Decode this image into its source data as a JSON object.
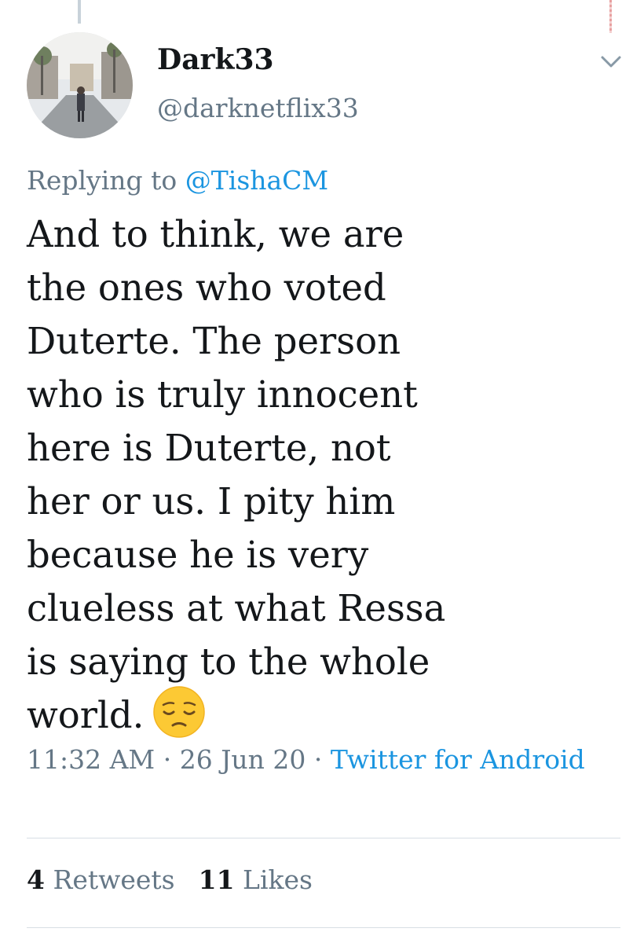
{
  "tweet": {
    "author": {
      "display_name": "Dark33",
      "handle": "@darknetflix33",
      "avatar": "avatar-photo-street"
    },
    "reply": {
      "prefix": "Replying to",
      "mention": "@TishaCM"
    },
    "text_lines": [
      "And to think, we are",
      "the ones who voted",
      "Duterte. The person",
      "who is truly innocent",
      "here is Duterte, not",
      "her or us. I pity him",
      "because he is very",
      "clueless at what Ressa",
      "is saying to the whole",
      "world."
    ],
    "emoji": "pensive-face-icon",
    "time": "11:32 AM",
    "date": "26 Jun 20",
    "separator": "·",
    "source": "Twitter for Android",
    "stats": {
      "retweets_count": "4",
      "retweets_label": "Retweets",
      "likes_count": "11",
      "likes_label": "Likes"
    },
    "menu_icon": "chevron-down-icon"
  },
  "colors": {
    "text": "#14171a",
    "secondary": "#657786",
    "link": "#1b95e0",
    "divider": "#d7dee4"
  }
}
